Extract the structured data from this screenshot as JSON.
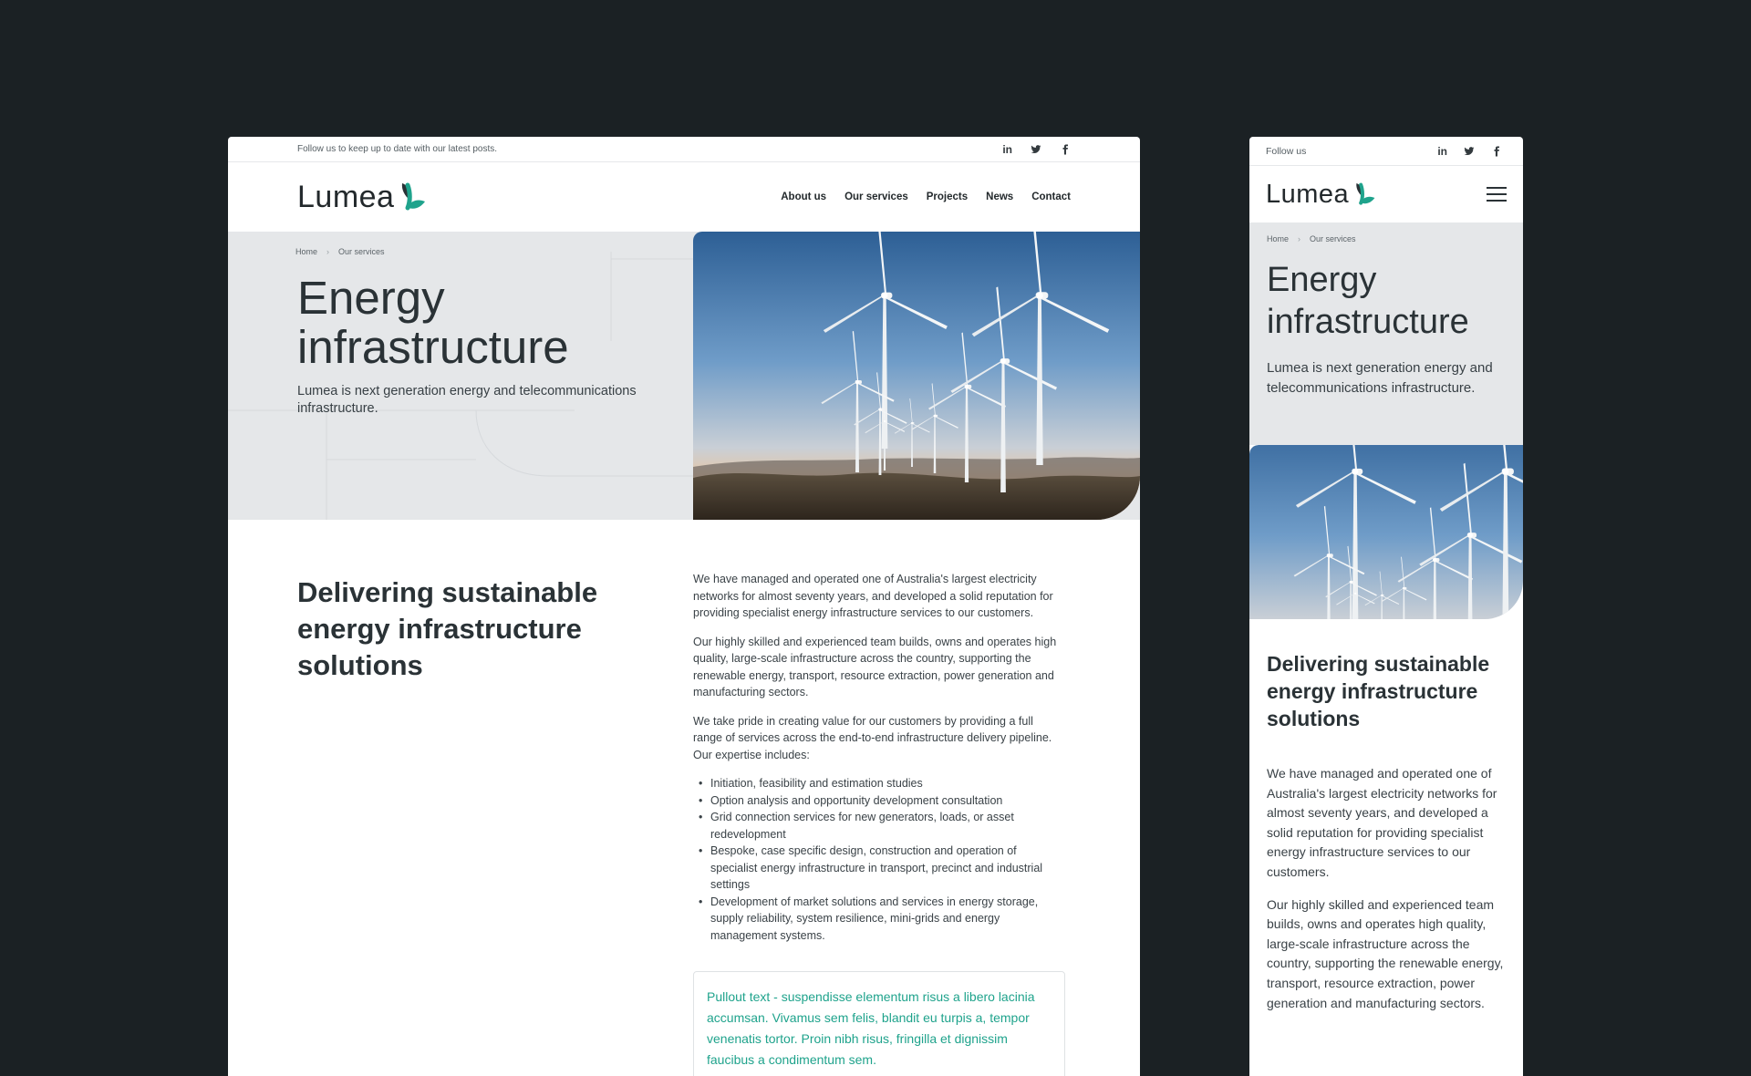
{
  "colors": {
    "background": "#1b2124",
    "accent": "#1fa38c",
    "hero_bg": "#e5e7e9"
  },
  "brand": {
    "name": "Lumea"
  },
  "social_icons": [
    "linkedin-icon",
    "twitter-icon",
    "facebook-icon"
  ],
  "desktop": {
    "topbar_text": "Follow us to keep up to date with our latest posts.",
    "nav": [
      "About us",
      "Our services",
      "Projects",
      "News",
      "Contact"
    ],
    "breadcrumb": [
      "Home",
      "Our services"
    ],
    "hero_title_line1": "Energy",
    "hero_title_line2": "infrastructure",
    "hero_lede": "Lumea is next generation energy and telecommunications infrastructure.",
    "section_heading": "Delivering sustainable energy infrastructure solutions",
    "paragraphs": [
      "We have managed and operated one of Australia's largest electricity networks for almost seventy years, and developed a solid reputation for providing specialist energy infrastructure services to our customers.",
      "Our highly skilled and experienced team builds, owns and operates high quality, large-scale infrastructure across the country, supporting the renewable energy, transport, resource extraction, power generation and manufacturing sectors.",
      "We take pride in creating value for our customers by providing a full range of services across the end-to-end infrastructure delivery pipeline. Our expertise includes:"
    ],
    "bullets": [
      "Initiation, feasibility and estimation studies",
      "Option analysis and opportunity development consultation",
      "Grid connection services for new generators, loads, or asset redevelopment",
      "Bespoke, case specific design, construction and operation of specialist energy infrastructure in transport, precinct and industrial settings",
      "Development of market solutions and services in energy storage, supply reliability, system resilience, mini-grids and energy management systems."
    ],
    "pullout": "Pullout text - suspendisse elementum risus a libero lacinia accumsan. Vivamus sem felis, blandit eu turpis a, tempor venenatis tortor. Proin nibh risus, fringilla et dignissim faucibus a condimentum sem."
  },
  "mobile": {
    "topbar_text": "Follow us",
    "breadcrumb": [
      "Home",
      "Our services"
    ],
    "hero_title_line1": "Energy",
    "hero_title_line2": "infrastructure",
    "hero_lede": "Lumea is next generation energy and telecommunications infrastructure.",
    "section_heading": "Delivering sustainable energy infrastructure solutions",
    "paragraphs": [
      "We have managed and operated one of Australia's largest electricity networks for almost seventy years, and developed a solid reputation for providing specialist energy infrastructure services to our customers.",
      "Our highly skilled and experienced team builds, owns and operates high quality, large-scale infrastructure across the country, supporting the renewable energy, transport, resource extraction, power generation and manufacturing sectors."
    ]
  }
}
